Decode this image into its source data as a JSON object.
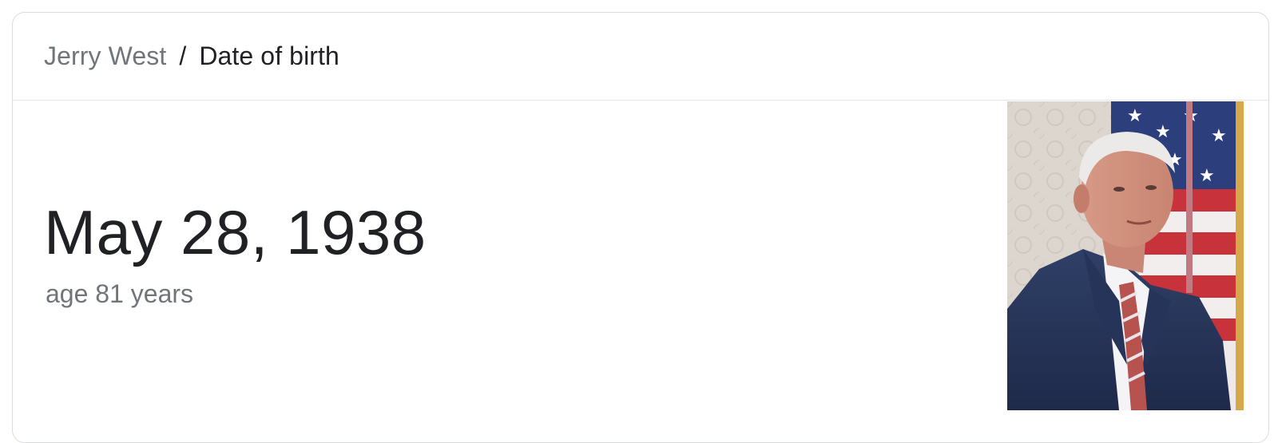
{
  "breadcrumb": {
    "entity": "Jerry West",
    "separator": "/",
    "attribute": "Date of birth"
  },
  "answer": {
    "value": "May 28, 1938",
    "subtitle": "age 81 years"
  },
  "photo": {
    "alt": "Jerry West"
  },
  "colors": {
    "primary_text": "#202124",
    "secondary_text": "#70757a",
    "border": "#dadce0"
  }
}
